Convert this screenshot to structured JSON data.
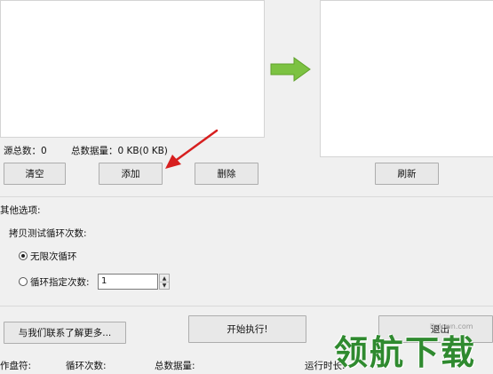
{
  "source": {
    "count_label": "源总数：0",
    "size_label": "总数据量：0 KB(0 KB)"
  },
  "buttons": {
    "clear": "清空",
    "add": "添加",
    "delete": "删除",
    "refresh": "刷新",
    "contact": "与我们联系了解更多...",
    "start": "开始执行!",
    "exit": "退出"
  },
  "options": {
    "group_title": "其他选项:",
    "loop_title": "拷贝测试循环次数:",
    "radio_infinite": "无限次循环",
    "radio_count": "循环指定次数:",
    "count_value": "1"
  },
  "footer": {
    "work_disk": "作盘符:",
    "loops": "循环次数:",
    "total_data": "总数据量:",
    "run_time": "运行时长:"
  },
  "watermark": {
    "site": "lhdown.com",
    "brand": "领航下载"
  },
  "colors": {
    "arrow": "#7cc242",
    "pointer": "#d71f1f",
    "brand": "#2f8a2f"
  }
}
